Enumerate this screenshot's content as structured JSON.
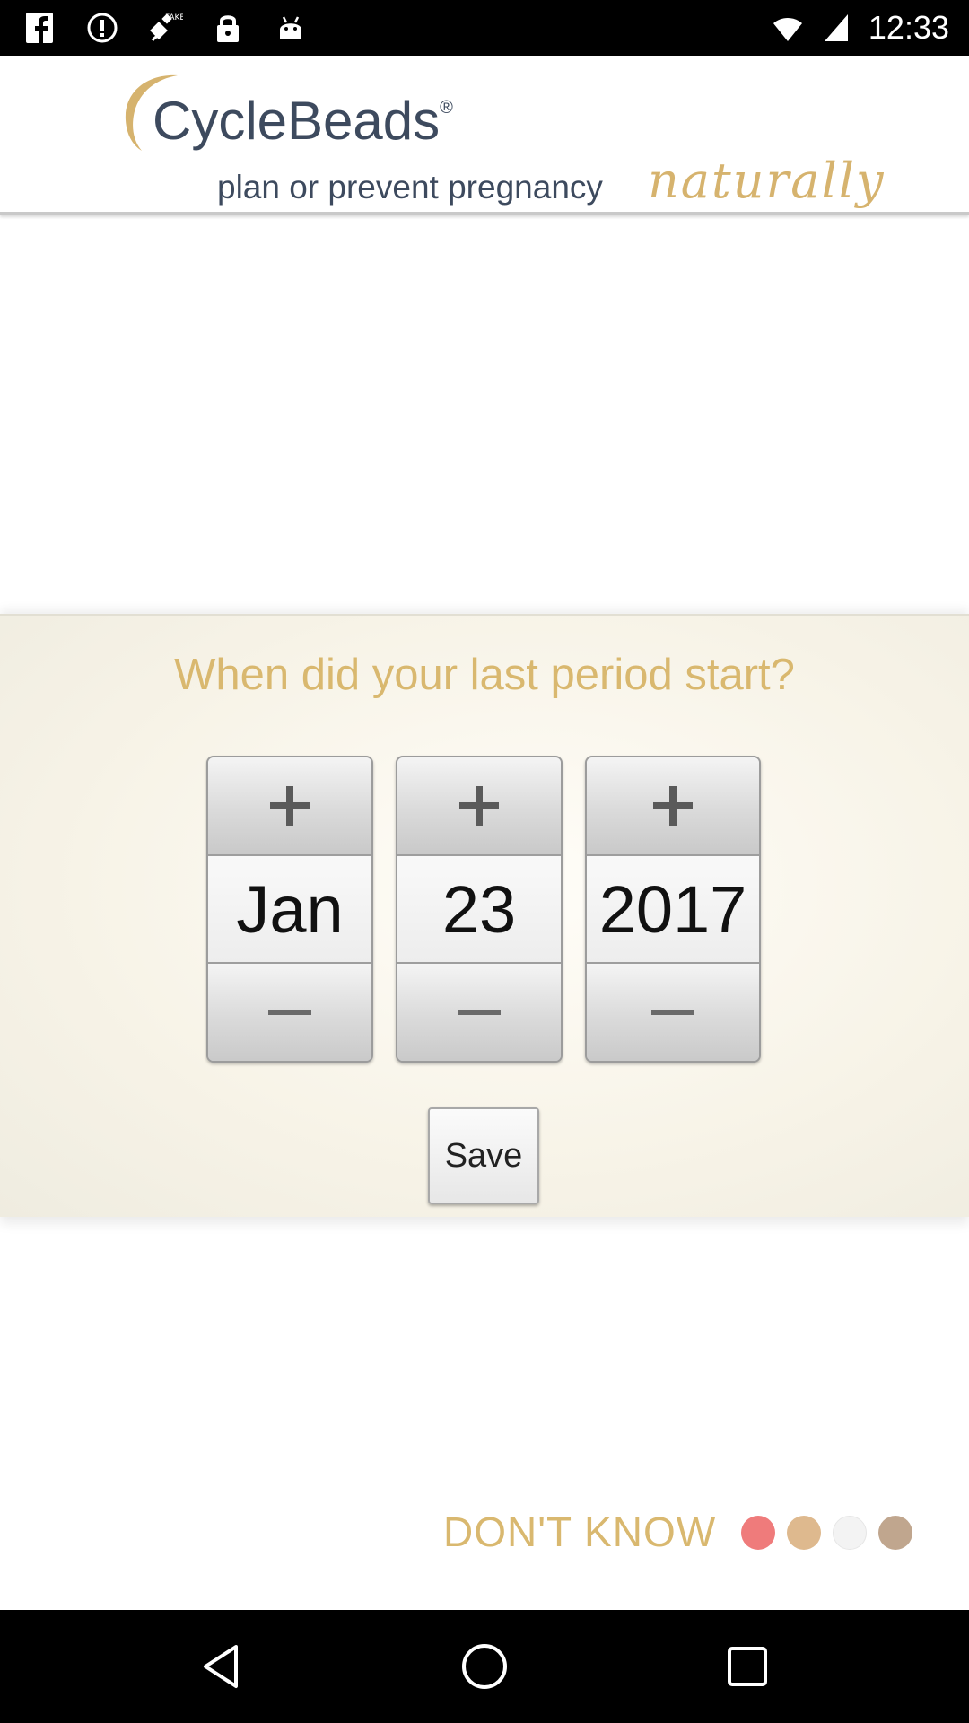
{
  "status_bar": {
    "time": "12:33",
    "left_icons": [
      "facebook-icon",
      "alert-circle-icon",
      "fake-gps-icon",
      "lock-icon",
      "android-icon"
    ],
    "right_icons": [
      "wifi-icon",
      "signal-icon"
    ]
  },
  "header": {
    "brand": "CycleBeads",
    "registered": "®",
    "tagline": "plan or prevent pregnancy",
    "tagline_accent": "naturally"
  },
  "date_picker": {
    "question": "When did your last period start?",
    "month": "Jan",
    "day": "23",
    "year": "2017",
    "plus_symbol": "+",
    "minus_symbol": "−"
  },
  "save_label": "Save",
  "dont_know_label": "DON'T KNOW",
  "bead_colors": [
    "#ef7b7b",
    "#deb98e",
    "#f3f3f3",
    "#c0a68e"
  ],
  "colors": {
    "accent_gold": "#d9b86f",
    "brand_navy": "#3d4a5e"
  }
}
